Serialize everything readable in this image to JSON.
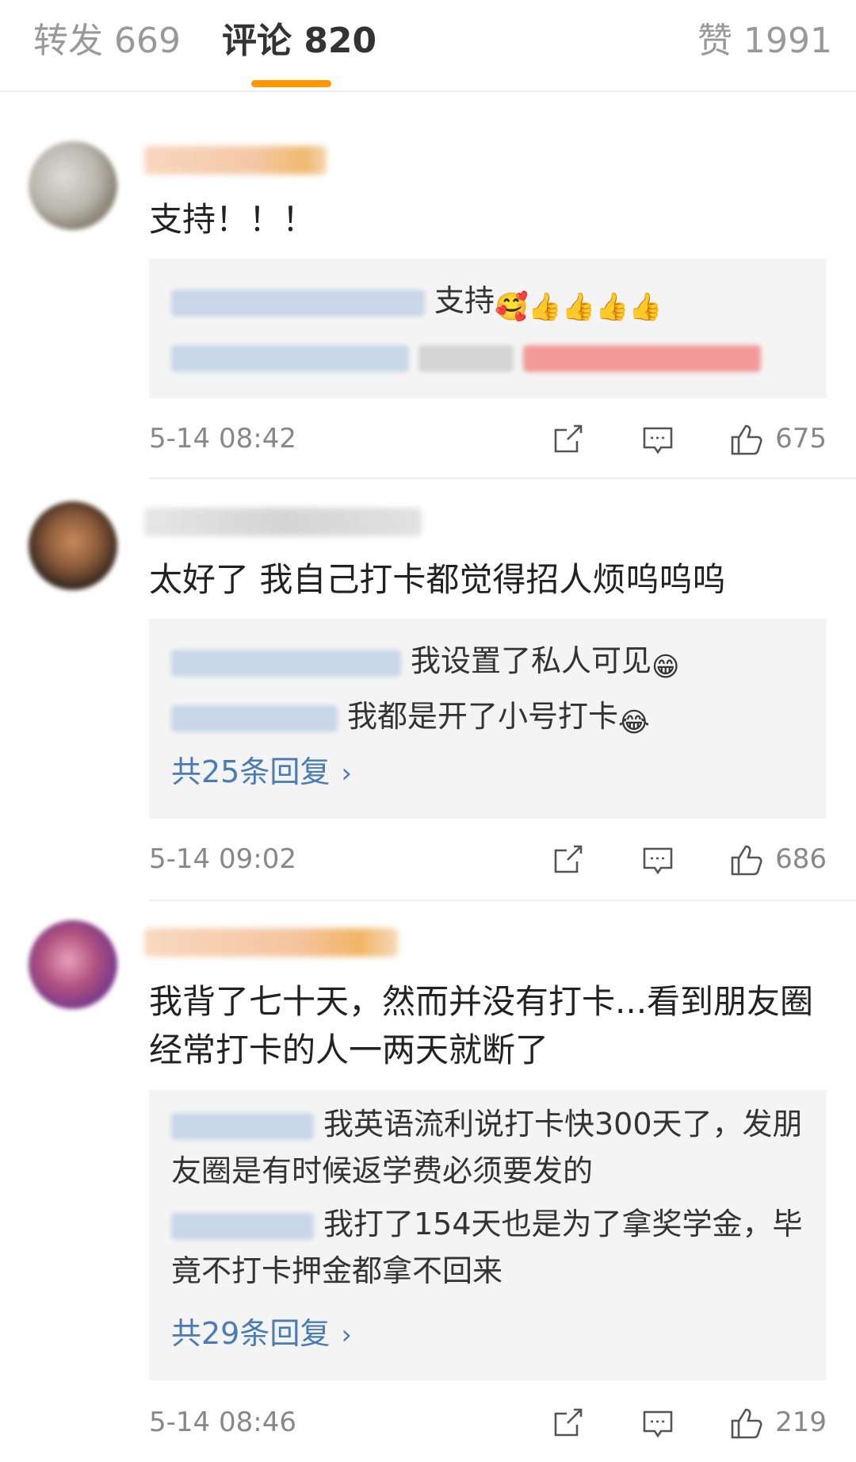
{
  "tabs": [
    {
      "label": "转发 669",
      "active": false
    },
    {
      "label": "评论 820",
      "active": true
    },
    {
      "label": "赞 1991",
      "active": false
    }
  ],
  "colors": {
    "accent": "#ff9800",
    "link": "#4a7bb7",
    "reply_bg": "#f4f4f4"
  },
  "comments": [
    {
      "body": "支持！！！",
      "replies": [
        {
          "text": "支持",
          "emoji": "🥰👍👍👍👍"
        },
        {
          "text": "",
          "emoji": ""
        }
      ],
      "more_replies": "",
      "time": "5-14 08:42",
      "likes": "675"
    },
    {
      "body": "太好了 我自己打卡都觉得招人烦呜呜呜",
      "replies": [
        {
          "text": "我设置了私人可见",
          "emoji": "😁"
        },
        {
          "text": "我都是开了小号打卡",
          "emoji": "😂"
        }
      ],
      "more_replies": "共25条回复",
      "time": "5-14 09:02",
      "likes": "686"
    },
    {
      "body": "我背了七十天，然而并没有打卡...看到朋友圈经常打卡的人一两天就断了",
      "replies": [
        {
          "text": "我英语流利说打卡快300天了，发朋友圈是有时候返学费必须要发的",
          "emoji": ""
        },
        {
          "text": "我打了154天也是为了拿奖学金，毕竟不打卡押金都拿不回来",
          "emoji": ""
        }
      ],
      "more_replies": "共29条回复",
      "time": "5-14 08:46",
      "likes": "219"
    }
  ],
  "icons": {
    "share": "share-icon",
    "comment": "comment-icon",
    "like": "thumbs-up-icon",
    "chevron": "chevron-right-icon"
  },
  "chevron": "›"
}
